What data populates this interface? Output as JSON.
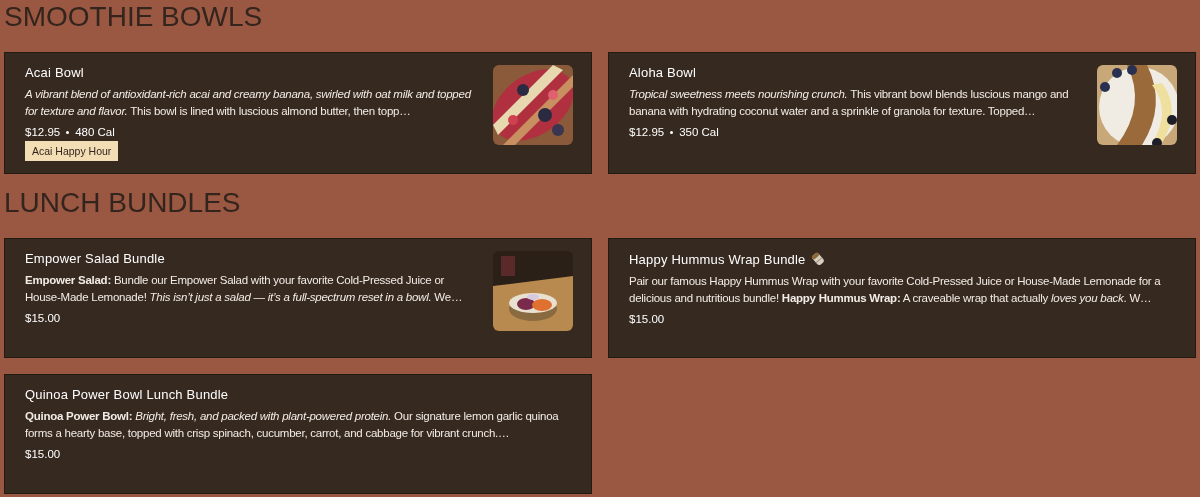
{
  "sections": [
    {
      "heading": "SMOOTHIE BOWLS",
      "items": [
        {
          "name": "Acai Bowl",
          "description": "*A vibrant blend of antioxidant-rich acai and creamy banana, swirled with oat milk and topped for texture and flavor.* This bowl is lined with luscious almond butter, then topp…",
          "price": "$12.95",
          "calories": "480 Cal",
          "tag": "Acai Happy Hour"
        },
        {
          "name": "Aloha Bowl",
          "description": "*Tropical sweetness meets nourishing crunch.* This vibrant bowl blends luscious mango and banana with hydrating coconut water and a sprinkle of granola for texture. Topped…",
          "price": "$12.95",
          "calories": "350 Cal"
        }
      ]
    },
    {
      "heading": "LUNCH BUNDLES",
      "items": [
        {
          "name": "Empower Salad Bundle",
          "description": "**Empower Salad:** Bundle our Empower Salad with your favorite Cold-Pressed Juice or House-Made Lemonade! *This isn’t just a salad — it’s a full-spectrum reset in a bowl.* We…",
          "price": "$15.00"
        },
        {
          "name": "Happy Hummus Wrap Bundle",
          "title_icon": true,
          "description": "Pair our famous Happy Hummus Wrap with your favorite Cold-Pressed Juice or House-Made Lemonade for a delicious and nutritious bundle! **Happy Hummus Wrap:** A craveable wrap that actually *loves you back*. W…",
          "price": "$15.00"
        },
        {
          "name": "Quinoa Power Bowl Lunch Bundle",
          "description": "**Quinoa Power Bowl:** *Bright, fresh, and packed with plant-powered protein.* Our signature lemon garlic quinoa forms a hearty base, topped with crisp spinach, cucumber, carrot, and cabbage for vibrant crunch.…",
          "price": "$15.00"
        }
      ]
    }
  ]
}
